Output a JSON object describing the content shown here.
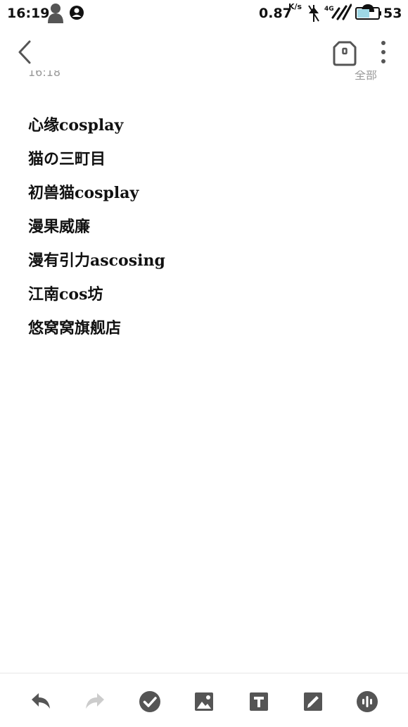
{
  "status_bar": {
    "time": "16:19",
    "net_speed": "0.87",
    "net_speed_unit": "K/s",
    "network_type": "4G",
    "battery": "53",
    "icons": [
      "person-silhouette-icon",
      "account-icon",
      "no-signal-icon",
      "signal-icon",
      "alarm-icon",
      "battery-icon"
    ]
  },
  "top_bar": {
    "icons": [
      "back-icon",
      "tag-icon",
      "more-vert-icon"
    ]
  },
  "note_meta": {
    "date": "16:18",
    "folder": "全部"
  },
  "note": {
    "lines": [
      "心缘cosplay",
      "猫の三町目",
      "初兽猫cosplay",
      "漫果威廉",
      "漫有引力ascosing",
      "江南cos坊",
      "悠窝窝旗舰店"
    ]
  },
  "bottom_toolbar": {
    "icons": [
      "undo-icon",
      "redo-icon",
      "checklist-icon",
      "image-icon",
      "text-format-icon",
      "draw-icon",
      "audio-icon"
    ],
    "colors": {
      "active": "#555555",
      "disabled": "#cccccc"
    }
  }
}
